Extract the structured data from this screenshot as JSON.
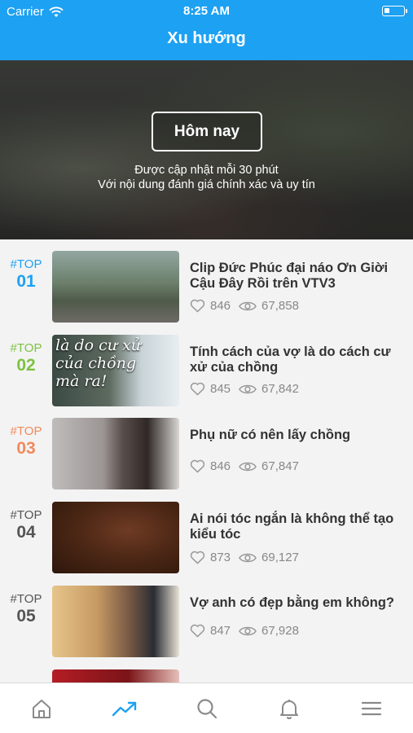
{
  "status": {
    "carrier": "Carrier",
    "time": "8:25 AM"
  },
  "nav": {
    "title": "Xu hướng"
  },
  "hero": {
    "button_label": "Hôm nay",
    "line1": "Được cập nhật mỗi 30 phút",
    "line2": "Với nội dung đánh giá chính xác và uy tín"
  },
  "items": [
    {
      "tag": "#TOP",
      "rank": "01",
      "color": "#1da1f2",
      "title": "Clip Đức Phúc đại náo Ơn Giời Cậu Đây Rồi  trên VTV3",
      "likes": "846",
      "views": "67,858"
    },
    {
      "tag": "#TOP",
      "rank": "02",
      "color": "#7dc242",
      "title": "Tính cách của vợ là do cách cư xử của chồng",
      "likes": "845",
      "views": "67,842",
      "thumb_text": "là do cư xử\ncủa chồng\nmà ra!"
    },
    {
      "tag": "#TOP",
      "rank": "03",
      "color": "#f08a5d",
      "title": "Phụ nữ có nên lấy chồng",
      "likes": "846",
      "views": "67,847"
    },
    {
      "tag": "#TOP",
      "rank": "04",
      "color": "#555555",
      "title": "Ai nói tóc ngắn là không thể tạo kiểu tóc",
      "likes": "873",
      "views": "69,127"
    },
    {
      "tag": "#TOP",
      "rank": "05",
      "color": "#555555",
      "title": "Vợ anh có đẹp bằng em không?",
      "likes": "847",
      "views": "67,928"
    }
  ],
  "tabs": [
    {
      "name": "home-icon"
    },
    {
      "name": "trending-icon",
      "active": true
    },
    {
      "name": "search-icon"
    },
    {
      "name": "bell-icon"
    },
    {
      "name": "menu-icon"
    }
  ],
  "colors": {
    "primary": "#1da1f2",
    "tab_inactive": "#8a8a8a"
  }
}
